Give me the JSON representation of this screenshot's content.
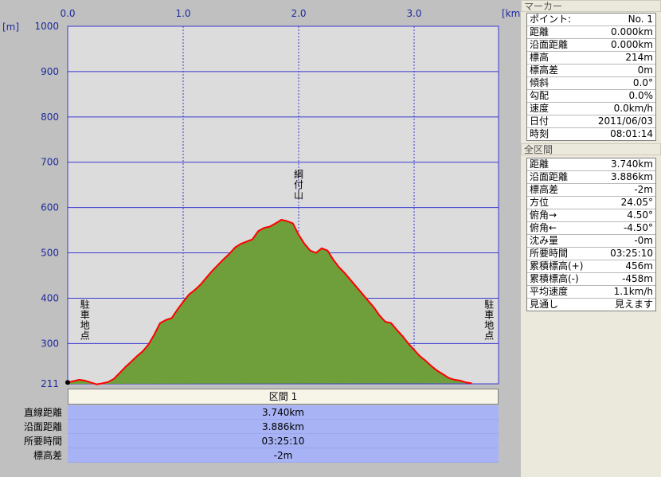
{
  "chart_data": {
    "type": "area",
    "x_unit": "[km]",
    "y_unit": "[m]",
    "xlim": [
      0,
      3.74
    ],
    "ylim": [
      211,
      1000
    ],
    "x_ticks": [
      "0.0",
      "1.0",
      "2.0",
      "3.0"
    ],
    "x_tick_values": [
      0,
      1,
      2,
      3
    ],
    "y_ticks": [
      "1000",
      "900",
      "800",
      "700",
      "600",
      "500",
      "400",
      "300",
      "211"
    ],
    "y_tick_values": [
      1000,
      900,
      800,
      700,
      600,
      500,
      400,
      300,
      211
    ],
    "x": [
      0,
      0.05,
      0.1,
      0.15,
      0.2,
      0.25,
      0.3,
      0.35,
      0.4,
      0.45,
      0.5,
      0.55,
      0.6,
      0.65,
      0.7,
      0.75,
      0.8,
      0.85,
      0.9,
      0.95,
      1.0,
      1.05,
      1.1,
      1.15,
      1.2,
      1.25,
      1.3,
      1.35,
      1.4,
      1.45,
      1.5,
      1.55,
      1.6,
      1.65,
      1.7,
      1.75,
      1.8,
      1.85,
      1.9,
      1.95,
      2.0,
      2.05,
      2.1,
      2.15,
      2.2,
      2.25,
      2.3,
      2.35,
      2.4,
      2.45,
      2.5,
      2.55,
      2.6,
      2.65,
      2.7,
      2.75,
      2.8,
      2.85,
      2.9,
      2.95,
      3.0,
      3.05,
      3.1,
      3.15,
      3.2,
      3.25,
      3.3,
      3.35,
      3.4,
      3.45,
      3.5,
      3.55,
      3.6,
      3.65,
      3.7,
      3.74
    ],
    "y": [
      214,
      217,
      220,
      218,
      214,
      210,
      212,
      215,
      222,
      235,
      248,
      260,
      272,
      283,
      298,
      320,
      345,
      352,
      356,
      375,
      392,
      408,
      418,
      430,
      445,
      460,
      473,
      486,
      498,
      512,
      520,
      525,
      530,
      548,
      555,
      558,
      565,
      573,
      570,
      565,
      540,
      520,
      505,
      500,
      510,
      505,
      485,
      468,
      455,
      440,
      425,
      410,
      395,
      380,
      362,
      348,
      345,
      330,
      316,
      300,
      286,
      272,
      262,
      250,
      240,
      232,
      224,
      220,
      218,
      214,
      212
    ],
    "annotations": [
      {
        "label": "駐車地点",
        "x": 0.15,
        "y": 310
      },
      {
        "label": "綱付山",
        "x": 2.0,
        "y": 620
      },
      {
        "label": "駐車地点",
        "x": 3.65,
        "y": 310
      }
    ],
    "colors": {
      "fill": "#6f9f3a",
      "line": "#ff0000",
      "grid": "#3a3ad0",
      "plot_bg": "#dcdcdc"
    }
  },
  "section": {
    "header": "区間 1",
    "rows": [
      {
        "label": "直線距離",
        "value": "3.740km"
      },
      {
        "label": "沿面距離",
        "value": "3.886km"
      },
      {
        "label": "所要時間",
        "value": "03:25:10"
      },
      {
        "label": "標高差",
        "value": "-2m"
      }
    ]
  },
  "marker_panel": {
    "title": "マーカー",
    "rows": [
      {
        "k": "ポイント:",
        "v": "No. 1"
      },
      {
        "k": "距離",
        "v": "0.000km"
      },
      {
        "k": "沿面距離",
        "v": "0.000km"
      },
      {
        "k": "標高",
        "v": "214m"
      },
      {
        "k": "標高差",
        "v": "0m"
      },
      {
        "k": "傾斜",
        "v": "0.0°"
      },
      {
        "k": "勾配",
        "v": "0.0%"
      },
      {
        "k": "速度",
        "v": "0.0km/h"
      },
      {
        "k": "日付",
        "v": "2011/06/03"
      },
      {
        "k": "時刻",
        "v": "08:01:14"
      }
    ]
  },
  "total_panel": {
    "title": "全区間",
    "rows": [
      {
        "k": "距離",
        "v": "3.740km"
      },
      {
        "k": "沿面距離",
        "v": "3.886km"
      },
      {
        "k": "標高差",
        "v": "-2m"
      },
      {
        "k": "方位",
        "v": "24.05°"
      },
      {
        "k": "俯角→",
        "v": "4.50°"
      },
      {
        "k": "俯角←",
        "v": "-4.50°"
      },
      {
        "k": "沈み量",
        "v": "-0m"
      },
      {
        "k": "所要時間",
        "v": "03:25:10"
      },
      {
        "k": "累積標高(+)",
        "v": "456m"
      },
      {
        "k": "累積標高(-)",
        "v": "-458m"
      },
      {
        "k": "平均速度",
        "v": "1.1km/h"
      },
      {
        "k": "見通し",
        "v": "見えます"
      }
    ]
  }
}
